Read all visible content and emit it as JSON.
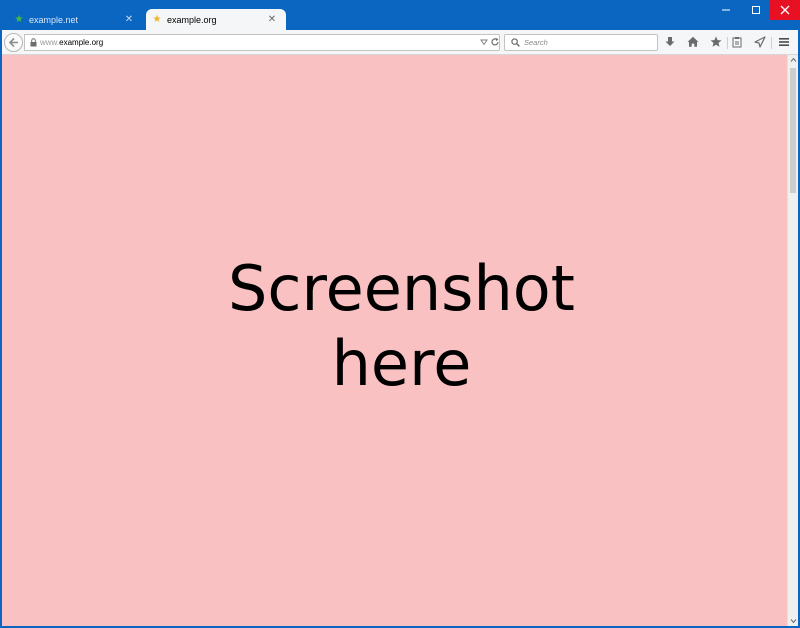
{
  "tabs": [
    {
      "title": "example.net",
      "favicon": "green-star-icon",
      "active": false
    },
    {
      "title": "example.org",
      "favicon": "yellow-star-icon",
      "active": true
    }
  ],
  "urlbar": {
    "subdomain": "www.",
    "domain": "example.org"
  },
  "search": {
    "placeholder": "Search"
  },
  "content": {
    "line1": "Screenshot",
    "line2": "here",
    "background": "#f9c1c1"
  },
  "colors": {
    "titlebar": "#0b66c2",
    "close_button": "#e81123"
  }
}
